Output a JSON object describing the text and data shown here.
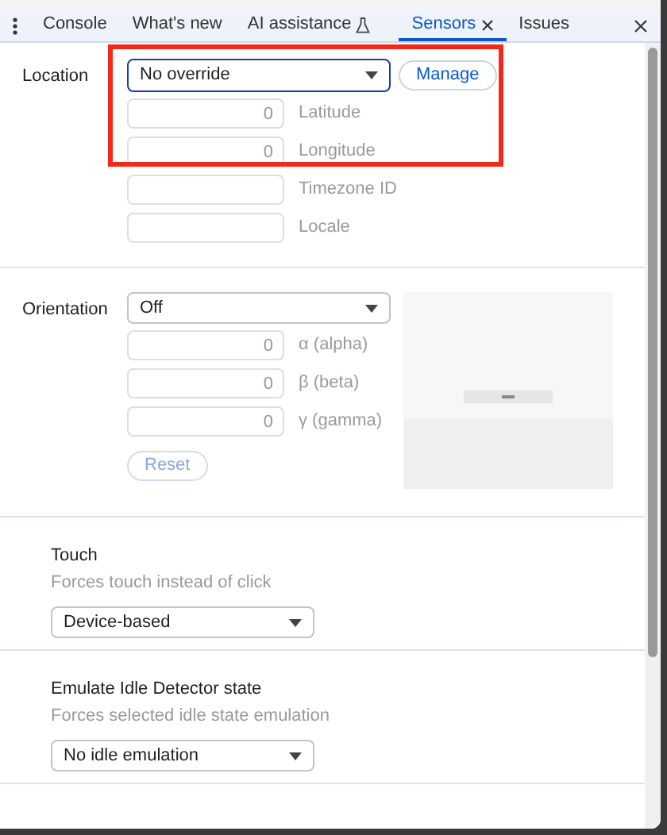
{
  "tabs": [
    {
      "label": "Console",
      "selected": false
    },
    {
      "label": "What's new",
      "selected": false
    },
    {
      "label": "AI assistance",
      "selected": false,
      "kind": "experimental"
    },
    {
      "label": "Sensors",
      "selected": true,
      "kind": "closable"
    },
    {
      "label": "Issues",
      "selected": false
    }
  ],
  "location": {
    "label": "Location",
    "select": "No override",
    "button": "Manage",
    "highlighted": true,
    "fields": [
      {
        "value": "0",
        "label": "Latitude"
      },
      {
        "value": "0",
        "label": "Longitude"
      },
      {
        "label": "Timezone ID"
      },
      {
        "label": "Locale"
      }
    ]
  },
  "orientation": {
    "label": "Orientation",
    "select": "Off",
    "button": "Reset",
    "fields": [
      {
        "value": "0",
        "label": "α (alpha)"
      },
      {
        "value": "0",
        "label": "β (beta)"
      },
      {
        "value": "0",
        "label": "γ (gamma)"
      }
    ]
  },
  "settings": [
    {
      "title": "Touch",
      "description": "Forces touch instead of click",
      "select": "Device-based"
    },
    {
      "title": "Emulate Idle Detector state",
      "description": "Forces selected idle state emulation",
      "select": "No idle emulation"
    }
  ]
}
